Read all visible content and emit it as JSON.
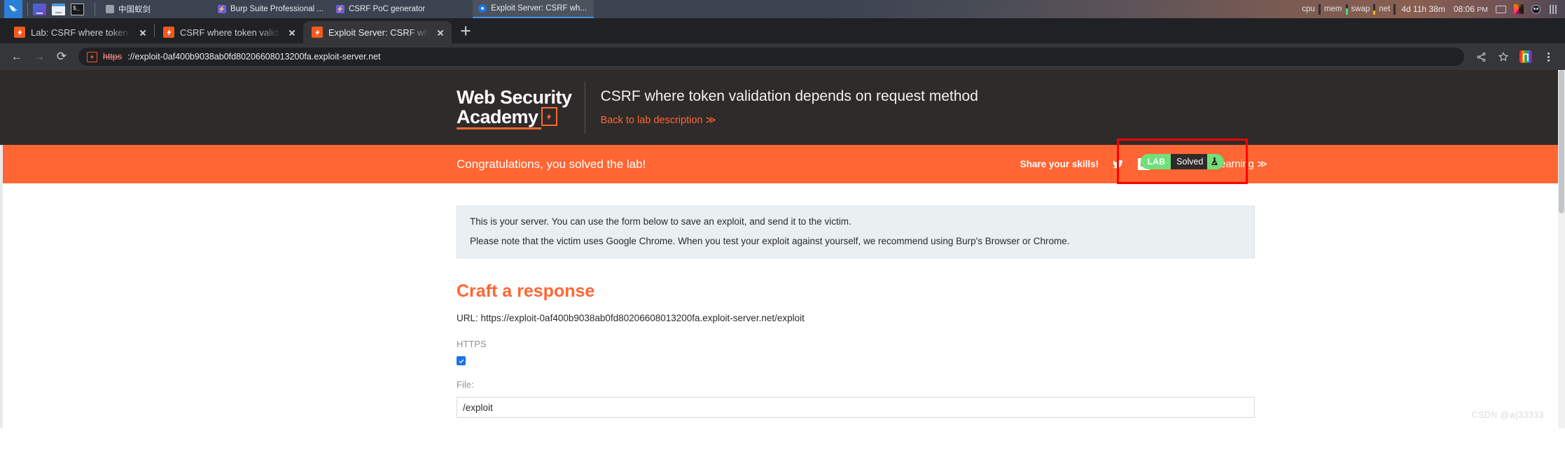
{
  "taskbar": {
    "launcher_icons": [
      {
        "name": "kali-menu-icon",
        "label": "Kali"
      },
      {
        "name": "browser-launcher-icon",
        "label": "Browser"
      },
      {
        "name": "file-manager-icon",
        "label": "Files"
      },
      {
        "name": "terminal-icon",
        "label": "$_"
      }
    ],
    "windows": [
      {
        "label": "中国蚁剑",
        "icon": "generic-app-icon",
        "active": false
      },
      {
        "label": "Burp Suite Professional ...",
        "icon": "burp-icon",
        "active": false
      },
      {
        "label": "CSRF PoC generator",
        "icon": "burp-icon",
        "active": false
      },
      {
        "label": "Exploit Server: CSRF wh...",
        "icon": "chrome-icon",
        "active": true
      }
    ],
    "monitors": [
      {
        "label": "cpu",
        "color": "#2a2f38",
        "fill": 0
      },
      {
        "label": "mem",
        "color": "#3ddc84",
        "fill": 55
      },
      {
        "label": "swap",
        "color": "#f5b200",
        "fill": 40
      },
      {
        "label": "net",
        "color": "#2a2f38",
        "fill": 0
      }
    ],
    "uptime": "4d 11h 38m",
    "clock": "08:06",
    "clock_ampm": "PM",
    "tray_icons": [
      "keyboard-icon",
      "cube-icon",
      "circle-icon",
      "bars-icon"
    ]
  },
  "browser": {
    "tabs": [
      {
        "title": "Lab: CSRF where token val",
        "active": false
      },
      {
        "title": "CSRF where token validati",
        "active": false
      },
      {
        "title": "Exploit Server: CSRF where",
        "active": true
      }
    ],
    "new_tab_label": "+",
    "nav": {
      "back": "←",
      "forward": "→",
      "reload": "⟳"
    },
    "address": {
      "scheme": "https",
      "rest": "://exploit-0af400b9038ab0fd80206608013200fa.exploit-server.net"
    },
    "actions": [
      "share-icon",
      "bookmark-star-icon",
      "extension-icon",
      "browser-menu-icon"
    ]
  },
  "header": {
    "logo_line1": "Web Security",
    "logo_line2": "Academy",
    "lab_title": "CSRF where token validation depends on request method",
    "back_link": "Back to lab description  ≫",
    "lab_status": {
      "tag": "LAB",
      "state": "Solved",
      "accent_color": "#71e07a",
      "highlight_color": "#ff0000"
    }
  },
  "banner": {
    "message": "Congratulations, you solved the lab!",
    "share_label": "Share your skills!",
    "social": [
      "twitter-icon",
      "linkedin-icon"
    ],
    "continue_label": "Continue learning ≫",
    "background_color": "#ff6633"
  },
  "notice": {
    "line1": "This is your server. You can use the form below to save an exploit, and send it to the victim.",
    "line2": "Please note that the victim uses Google Chrome. When you test your exploit against yourself, we recommend using Burp's Browser or Chrome."
  },
  "form": {
    "title": "Craft a response",
    "title_color": "#ff6633",
    "url_line": "URL: https://exploit-0af400b9038ab0fd80206608013200fa.exploit-server.net/exploit",
    "https_label": "HTTPS",
    "https_checked": true,
    "file_label": "File:",
    "file_value": "/exploit"
  },
  "watermark": "CSDN @wj33333"
}
